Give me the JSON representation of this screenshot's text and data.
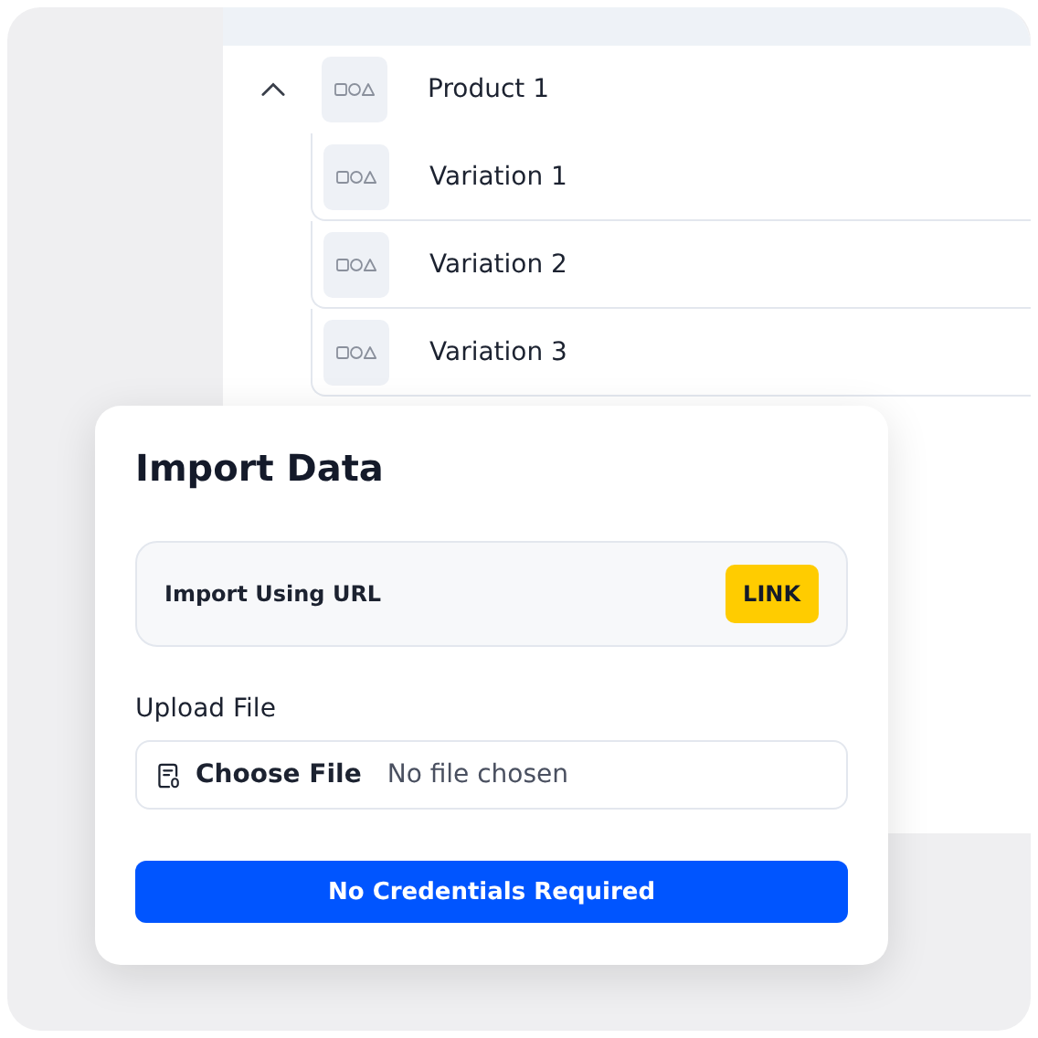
{
  "table": {
    "rows": [
      {
        "name": "Product 1",
        "expanded": true,
        "children": [
          {
            "name": "Variation 1"
          },
          {
            "name": "Variation 2"
          },
          {
            "name": "Variation 3"
          }
        ]
      }
    ]
  },
  "dialog": {
    "title": "Import Data",
    "url_import": {
      "label": "Import Using URL",
      "button": "LINK"
    },
    "upload": {
      "label": "Upload File",
      "button": "Choose File",
      "status": "No file chosen"
    },
    "primary_button": "No Credentials Required"
  }
}
